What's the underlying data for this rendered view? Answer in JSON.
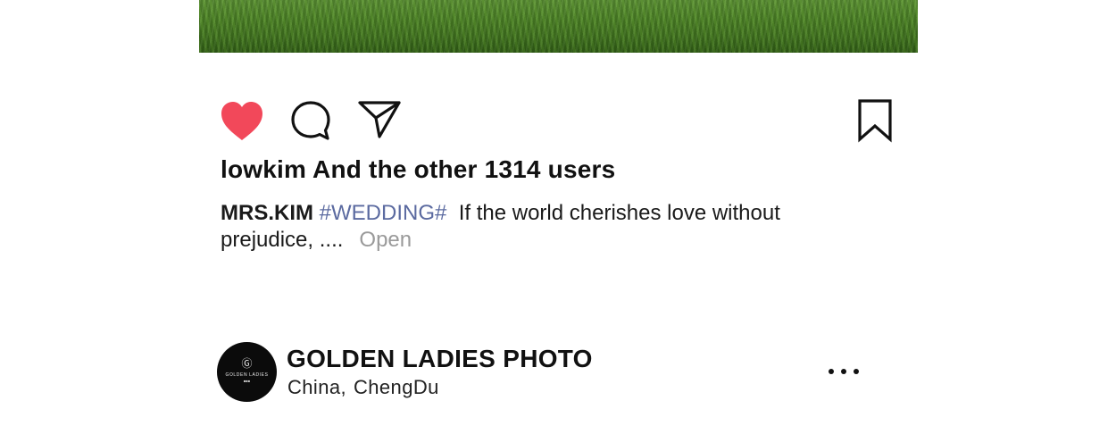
{
  "post": {
    "likes_text": "lowkim And the other 1314 users",
    "caption": {
      "author": "MRS.KIM",
      "hashtag": "#WEDDING#",
      "text_line1": "If the world cherishes love without",
      "text_line2": "prejudice, ....",
      "open_label": "Open"
    },
    "icons": {
      "like": "heart-icon",
      "comment": "comment-bubble-icon",
      "share": "paper-plane-icon",
      "save": "bookmark-icon",
      "more": "more-dots-icon"
    },
    "colors": {
      "like_active": "#f2485a",
      "hashtag": "#5b6aa0",
      "open_link": "#9a9a9a"
    }
  },
  "account": {
    "name": "GOLDEN LADIES PHOTO",
    "location_country": "China",
    "location_separator": ",",
    "location_city": "ChengDu",
    "avatar_logo_text": "GOLDEN LADIES"
  }
}
